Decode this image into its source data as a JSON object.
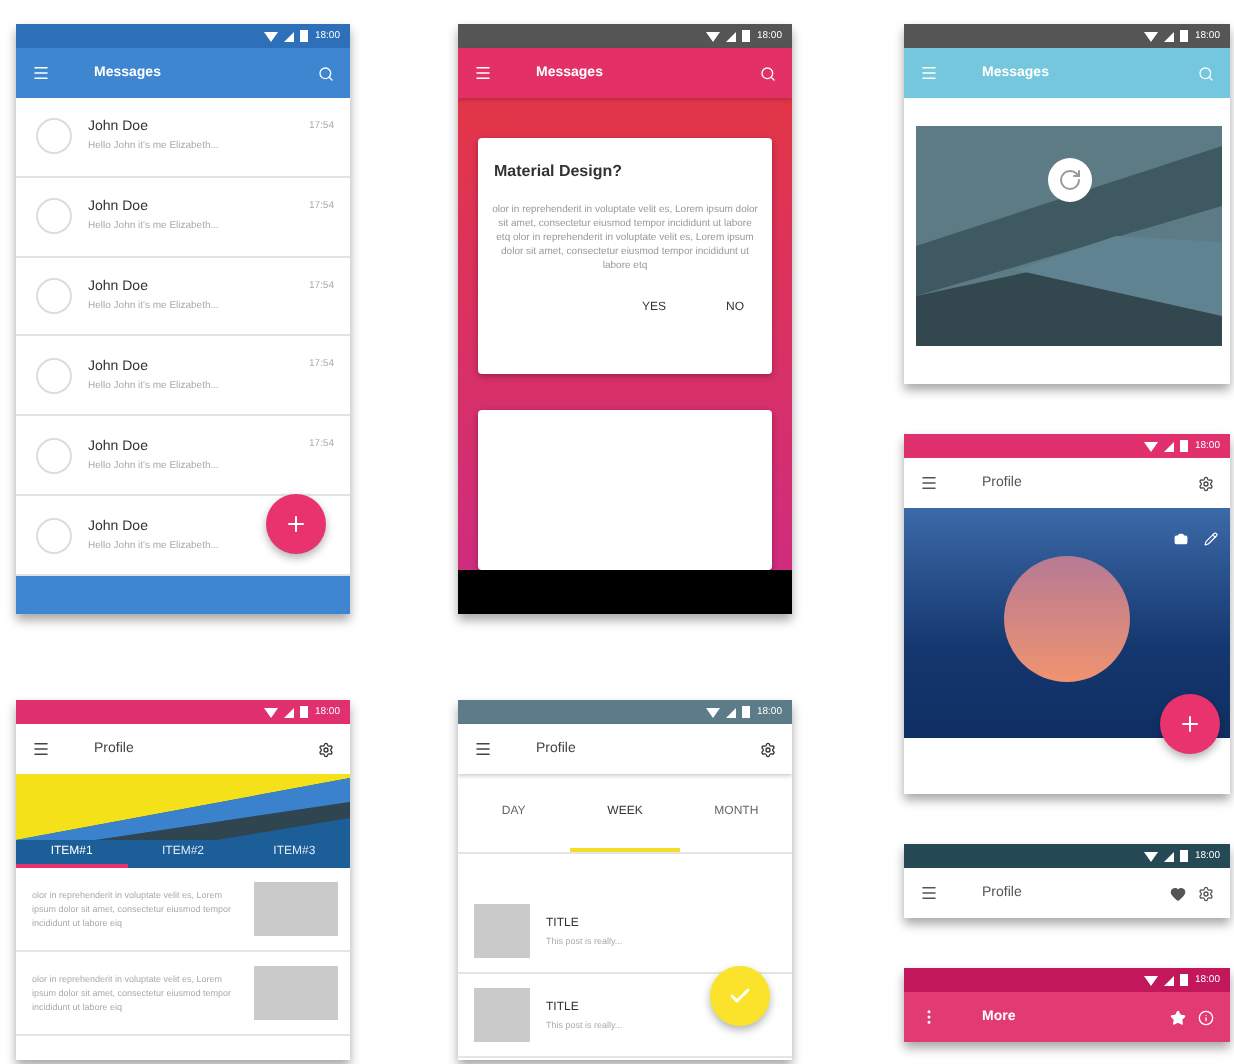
{
  "screens": [
    {
      "kind": "messages",
      "status_time": "18:00",
      "title": "Messages",
      "messages": [
        {
          "name": "John Doe",
          "preview": "Hello John it's me Elizabeth...",
          "time": "17:54"
        },
        {
          "name": "John Doe",
          "preview": "Hello John it's me Elizabeth...",
          "time": "17:54"
        },
        {
          "name": "John Doe",
          "preview": "Hello John it's me Elizabeth...",
          "time": "17:54"
        },
        {
          "name": "John Doe",
          "preview": "Hello John it's me Elizabeth...",
          "time": "17:54"
        },
        {
          "name": "John Doe",
          "preview": "Hello John it's me Elizabeth...",
          "time": "17:54"
        },
        {
          "name": "John Doe",
          "preview": "Hello John it's me Elizabeth..."
        }
      ]
    },
    {
      "kind": "profile_tabs",
      "status_time": "18:00",
      "title": "Profile",
      "tabs": [
        {
          "label": "ITEM#1",
          "selected": true
        },
        {
          "label": "ITEM#2",
          "selected": false
        },
        {
          "label": "ITEM#3",
          "selected": false
        }
      ],
      "items": [
        {
          "text": "olor in reprehenderit in voluptate velit es, Lorem ipsum dolor sit amet, consectetur eiusmod tempor incididunt ut labore eiq"
        },
        {
          "text": "olor in reprehenderit in voluptate velit es, Lorem ipsum dolor sit amet, consectetur eiusmod tempor incididunt ut labore eiq"
        }
      ]
    },
    {
      "kind": "dialog",
      "status_time": "18:00",
      "title": "Messages",
      "dialog": {
        "title": "Material Design?",
        "body": "olor in reprehenderit in voluptate velit es, Lorem ipsum dolor sit amet, consectetur eiusmod tempor incididunt ut labore etq olor in reprehenderit in voluptate velit es, Lorem ipsum dolor sit amet, consectetur eiusmod tempor incididunt ut labore etq",
        "actions": [
          "YES",
          "NO"
        ]
      }
    },
    {
      "kind": "calendar",
      "status_time": "18:00",
      "title": "Profile",
      "tabs": [
        {
          "label": "DAY",
          "selected": false
        },
        {
          "label": "WEEK",
          "selected": true
        },
        {
          "label": "MONTH",
          "selected": false
        }
      ],
      "items": [
        {
          "title": "TITLE",
          "subtitle": "This post is really..."
        },
        {
          "title": "TITLE",
          "subtitle": "This post is really..."
        }
      ]
    },
    {
      "kind": "image",
      "status_time": "18:00",
      "title": "Messages"
    },
    {
      "kind": "profile_photo",
      "status_time": "18:00",
      "title": "Profile"
    },
    {
      "kind": "toolbar_light",
      "status_time": "18:00",
      "title": "Profile"
    },
    {
      "kind": "toolbar_accent",
      "status_time": "18:00",
      "title": "More"
    }
  ]
}
